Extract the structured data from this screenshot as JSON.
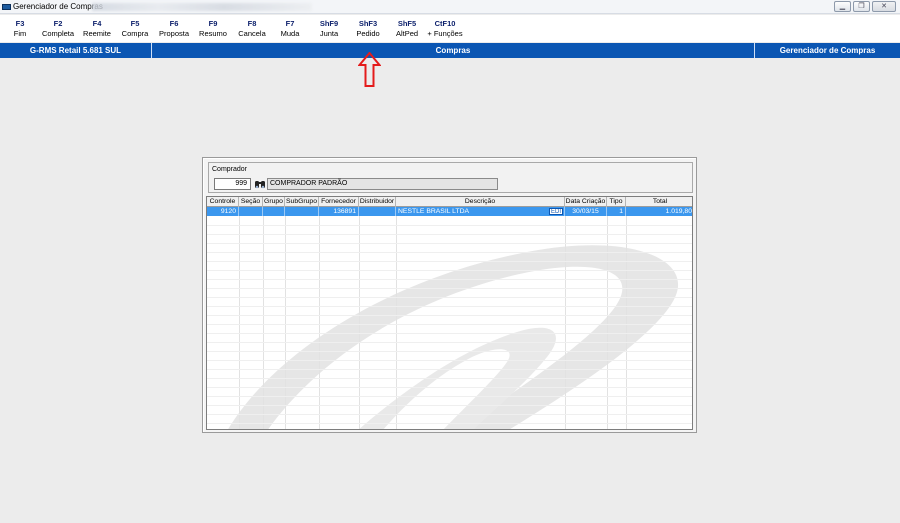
{
  "window": {
    "title": "Gerenciador de Compras",
    "buttons": [
      "▁",
      "❐",
      "✕"
    ]
  },
  "toolbar": [
    {
      "key": "F3",
      "label": "Fim"
    },
    {
      "key": "F2",
      "label": "Completa"
    },
    {
      "key": "F4",
      "label": "Reemite"
    },
    {
      "key": "F5",
      "label": "Compra"
    },
    {
      "key": "F6",
      "label": "Proposta"
    },
    {
      "key": "F9",
      "label": "Resumo"
    },
    {
      "key": "F8",
      "label": "Cancela"
    },
    {
      "key": "F7",
      "label": "Muda"
    },
    {
      "key": "ShF9",
      "label": "Junta"
    },
    {
      "key": "ShF3",
      "label": "Pedido"
    },
    {
      "key": "ShF5",
      "label": "AltPed"
    },
    {
      "key": "CtF10",
      "label": "+ Funções"
    }
  ],
  "statusbar": {
    "left": "G-RMS Retail 5.681 SUL",
    "center": "Compras",
    "right": "Gerenciador de Compras",
    "color": "#0b56b3"
  },
  "annotation": {
    "icon": "red-up-arrow",
    "color": "#e41b1b"
  },
  "comprador": {
    "label": "Comprador",
    "code": "999",
    "name": "COMPRADOR PADRÃO"
  },
  "grid": {
    "columns": [
      "Controle",
      "Seção",
      "Grupo",
      "SubGrupo",
      "Fornecedor",
      "Distribuidor",
      "Descrição",
      "Data Criação",
      "Tipo",
      "Total"
    ],
    "rows": [
      {
        "controle": "9120",
        "secao": "",
        "grupo": "",
        "subgrupo": "",
        "fornecedor": "136891",
        "distribuidor": "",
        "descricao": "NESTLE BRASIL LTDA",
        "badge": "EDI",
        "data_criacao": "30/03/15",
        "tipo": "1",
        "total": "1.019,80"
      }
    ],
    "selected_color": "#3b97ee"
  }
}
